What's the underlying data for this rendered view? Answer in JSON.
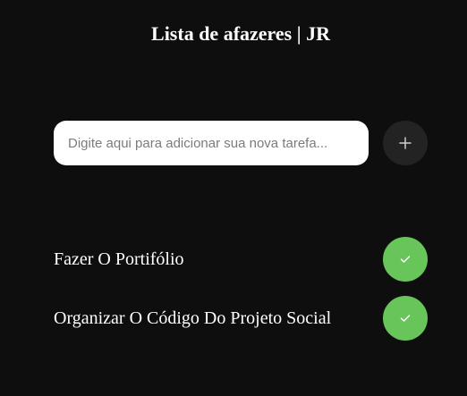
{
  "header": {
    "title": "Lista de afazeres | JR"
  },
  "new_task": {
    "placeholder": "Digite aqui para adicionar sua nova tarefa...",
    "value": ""
  },
  "icons": {
    "add": "plus-icon",
    "complete": "check-icon"
  },
  "colors": {
    "background": "#0f0e0f",
    "add_button": "#242324",
    "done_button": "#68c55a",
    "text": "#ffffff"
  },
  "tasks": [
    {
      "text": "Fazer O Portifólio"
    },
    {
      "text": "Organizar O Código Do Projeto Social"
    }
  ]
}
